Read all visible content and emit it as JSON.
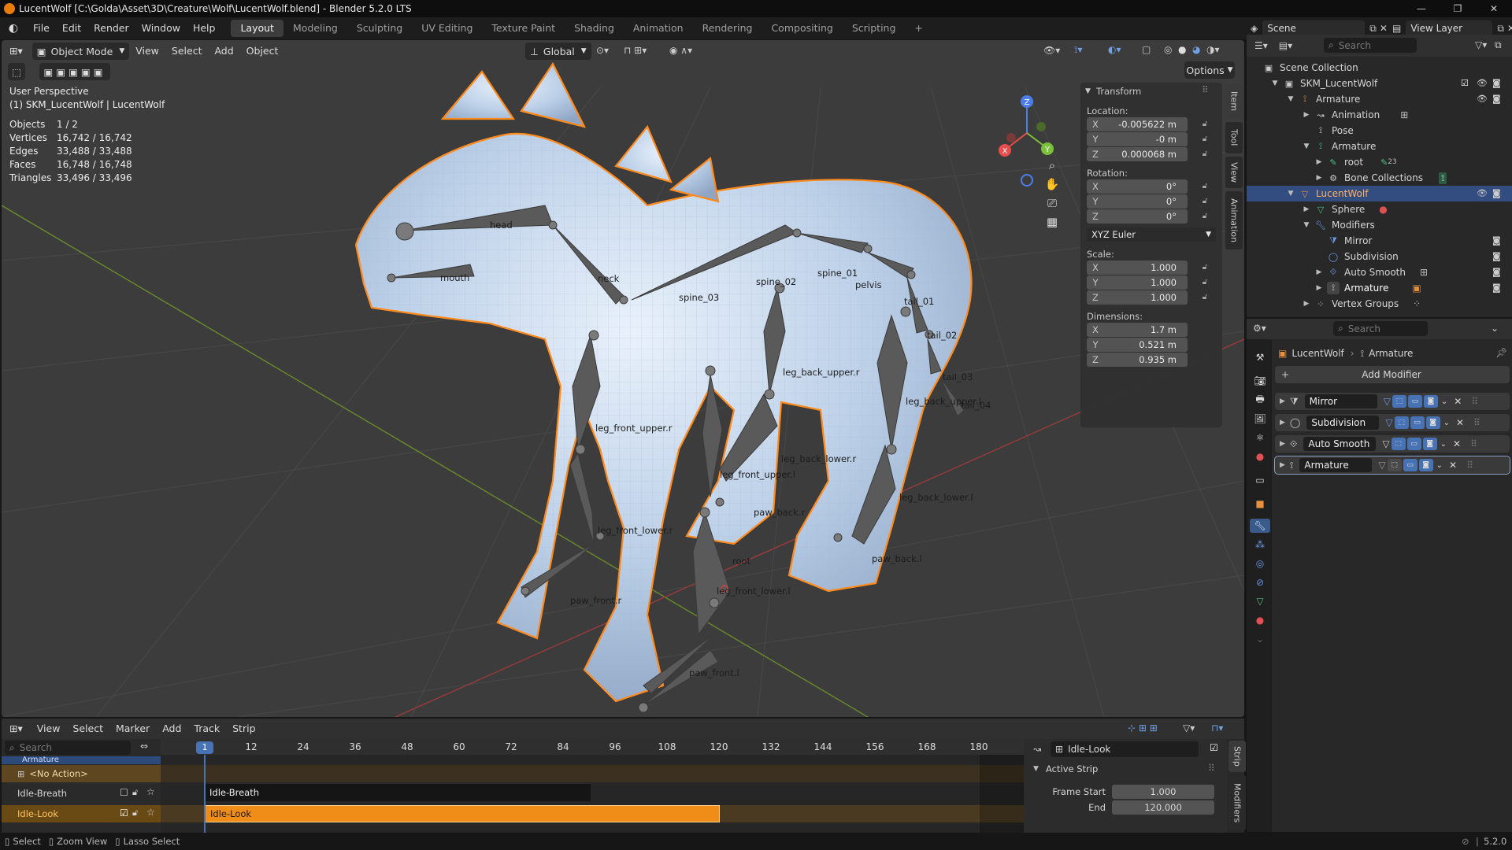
{
  "window": {
    "title": "LucentWolf [C:\\Golda\\Asset\\3D\\Creature\\Wolf\\LucentWolf.blend] - Blender 5.2.0 LTS",
    "minimize": "—",
    "maximize": "❐",
    "close": "✕"
  },
  "topbar": {
    "menus": [
      "File",
      "Edit",
      "Render",
      "Window",
      "Help"
    ],
    "workspaces": [
      "Layout",
      "Modeling",
      "Sculpting",
      "UV Editing",
      "Texture Paint",
      "Shading",
      "Animation",
      "Rendering",
      "Compositing",
      "Scripting"
    ],
    "active_workspace": "Layout",
    "add_tab": "+",
    "scene": "Scene",
    "view_layer": "View Layer"
  },
  "viewport": {
    "mode": "Object Mode",
    "menus": [
      "View",
      "Select",
      "Add",
      "Object"
    ],
    "orientation": "Global",
    "options": "Options",
    "perspective": "User Perspective",
    "active_object": "(1) SKM_LucentWolf | LucentWolf",
    "stats": [
      {
        "label": "Objects",
        "value": "1 / 2"
      },
      {
        "label": "Vertices",
        "value": "16,742 / 16,742"
      },
      {
        "label": "Edges",
        "value": "33,488 / 33,488"
      },
      {
        "label": "Faces",
        "value": "16,748 / 16,748"
      },
      {
        "label": "Triangles",
        "value": "33,496 / 33,496"
      }
    ],
    "gizmo": {
      "x": "X",
      "y": "Y",
      "z": "Z"
    },
    "bones": [
      "head",
      "neck",
      "mouth",
      "spine_03",
      "spine_02",
      "spine_01",
      "pelvis",
      "tail_01",
      "tail_02",
      "tail_03",
      "tail_04",
      "leg_back_upper.r",
      "leg_back_upper.l",
      "leg_back_lower.r",
      "leg_back_lower.l",
      "paw_back.r",
      "paw_back.l",
      "leg_front_upper.r",
      "leg_front_upper.l",
      "leg_front_lower.r",
      "leg_front_lower.l",
      "paw_front.r",
      "paw_front.l",
      "root"
    ]
  },
  "npanel": {
    "section": "Transform",
    "location_label": "Location:",
    "location": [
      {
        "axis": "X",
        "value": "-0.005622 m"
      },
      {
        "axis": "Y",
        "value": "-0 m"
      },
      {
        "axis": "Z",
        "value": "0.000068 m"
      }
    ],
    "rotation_label": "Rotation:",
    "rotation": [
      {
        "axis": "X",
        "value": "0°"
      },
      {
        "axis": "Y",
        "value": "0°"
      },
      {
        "axis": "Z",
        "value": "0°"
      }
    ],
    "rotation_mode": "XYZ Euler",
    "scale_label": "Scale:",
    "scale": [
      {
        "axis": "X",
        "value": "1.000"
      },
      {
        "axis": "Y",
        "value": "1.000"
      },
      {
        "axis": "Z",
        "value": "1.000"
      }
    ],
    "dimensions_label": "Dimensions:",
    "dimensions": [
      {
        "axis": "X",
        "value": "1.7 m"
      },
      {
        "axis": "Y",
        "value": "0.521 m"
      },
      {
        "axis": "Z",
        "value": "0.935 m"
      }
    ],
    "tabs": [
      "Item",
      "Tool",
      "View",
      "Animation"
    ]
  },
  "outliner": {
    "search_placeholder": "Search",
    "items": [
      {
        "label": "Scene Collection",
        "depth": 0
      },
      {
        "label": "SKM_LucentWolf",
        "depth": 1
      },
      {
        "label": "Armature",
        "depth": 2
      },
      {
        "label": "Animation",
        "depth": 3
      },
      {
        "label": "Pose",
        "depth": 3
      },
      {
        "label": "Armature",
        "depth": 3
      },
      {
        "label": "root",
        "depth": 4
      },
      {
        "label": "Bone Collections",
        "depth": 4
      },
      {
        "label": "LucentWolf",
        "depth": 2
      },
      {
        "label": "Sphere",
        "depth": 3
      },
      {
        "label": "Modifiers",
        "depth": 3
      },
      {
        "label": "Mirror",
        "depth": 4
      },
      {
        "label": "Subdivision",
        "depth": 4
      },
      {
        "label": "Auto Smooth",
        "depth": 4
      },
      {
        "label": "Armature",
        "depth": 4
      },
      {
        "label": "Vertex Groups",
        "depth": 3
      }
    ],
    "root_badge": "23"
  },
  "properties": {
    "search_placeholder": "Search",
    "breadcrumb_object": "LucentWolf",
    "breadcrumb_modifier": "Armature",
    "add_modifier": "Add Modifier",
    "modifiers": [
      "Mirror",
      "Subdivision",
      "Auto Smooth",
      "Armature"
    ]
  },
  "timeline": {
    "menus": [
      "View",
      "Select",
      "Marker",
      "Add",
      "Track",
      "Strip"
    ],
    "search_placeholder": "Search",
    "current_frame": "1",
    "frames": [
      "12",
      "24",
      "36",
      "48",
      "60",
      "72",
      "84",
      "96",
      "108",
      "120",
      "132",
      "144",
      "156",
      "168",
      "180"
    ],
    "tracks": {
      "armature": "Armature",
      "no_action": "<No Action>",
      "idle_breath": "Idle-Breath",
      "idle_look": "Idle-Look"
    },
    "strip_panel": {
      "active_name": "Idle-Look",
      "section": "Active Strip",
      "frame_start_label": "Frame Start",
      "frame_start": "1.000",
      "end_label": "End",
      "end": "120.000",
      "tabs": [
        "Strip",
        "Modifiers"
      ]
    }
  },
  "statusbar": {
    "select": "Select",
    "zoom": "Zoom View",
    "lasso": "Lasso Select",
    "version": "5.2.0"
  },
  "colors": {
    "accent": "#4772b3",
    "selection": "#ff8a1c",
    "viewport_bg": "#3c3c3c",
    "panel_bg": "#282828"
  }
}
